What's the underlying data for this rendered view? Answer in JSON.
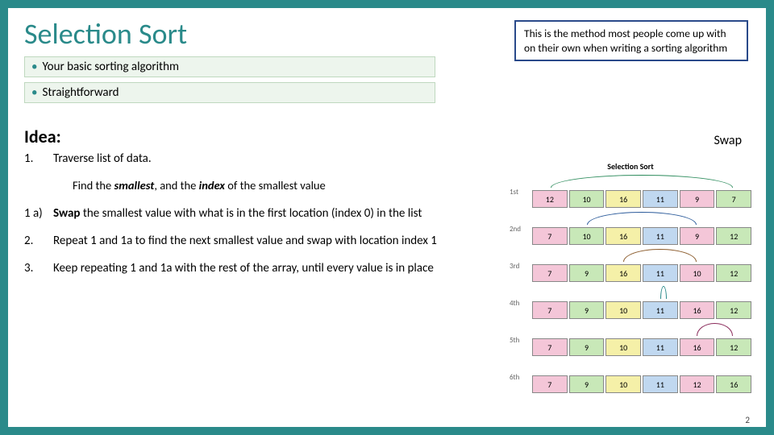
{
  "title": "Selection Sort",
  "callout": "This is the method most people come up with on their own when writing a sorting algorithm",
  "bullets": [
    "Your basic sorting algorithm",
    "Straightforward"
  ],
  "swap_label": "Swap",
  "idea_label": "Idea:",
  "steps": {
    "s1_num": "1.",
    "s1_txt": "Traverse list of data.",
    "s1_sub_a": "Find the ",
    "s1_sub_b": "smallest",
    "s1_sub_c": ", and the ",
    "s1_sub_d": "index",
    "s1_sub_e": " of the smallest value",
    "s1a_num": "1 a)",
    "s1a_a": "Swap",
    "s1a_b": " the smallest value with what is in the first location (index 0) in the list",
    "s2_num": "2.",
    "s2_txt": "Repeat 1 and 1a to find the next smallest value and swap with location index 1",
    "s3_num": "3.",
    "s3_txt": "Keep repeating 1 and 1a with the rest of the array, until every value is in place"
  },
  "page_num": "2",
  "chart_data": {
    "type": "table",
    "title": "Selection Sort",
    "row_labels": [
      "1st",
      "2nd",
      "3rd",
      "4th",
      "5th",
      "6th"
    ],
    "rows": [
      [
        12,
        10,
        16,
        11,
        9,
        7
      ],
      [
        7,
        10,
        16,
        11,
        9,
        12
      ],
      [
        7,
        9,
        16,
        11,
        10,
        12
      ],
      [
        7,
        9,
        10,
        11,
        16,
        12
      ],
      [
        7,
        9,
        10,
        11,
        16,
        12
      ],
      [
        7,
        9,
        10,
        11,
        12,
        16
      ]
    ],
    "sorted_prefix": [
      0,
      1,
      2,
      3,
      4,
      6
    ],
    "swap_arcs": [
      {
        "row": 0,
        "from": 0,
        "to": 5
      },
      {
        "row": 1,
        "from": 1,
        "to": 4
      },
      {
        "row": 2,
        "from": 2,
        "to": 4
      },
      {
        "row": 3,
        "from": 3,
        "to": 3
      },
      {
        "row": 4,
        "from": 4,
        "to": 5
      }
    ],
    "cell_colors": [
      "#f4c6d8",
      "#c8e8b8",
      "#f5f0a8",
      "#c0d8f0"
    ]
  }
}
